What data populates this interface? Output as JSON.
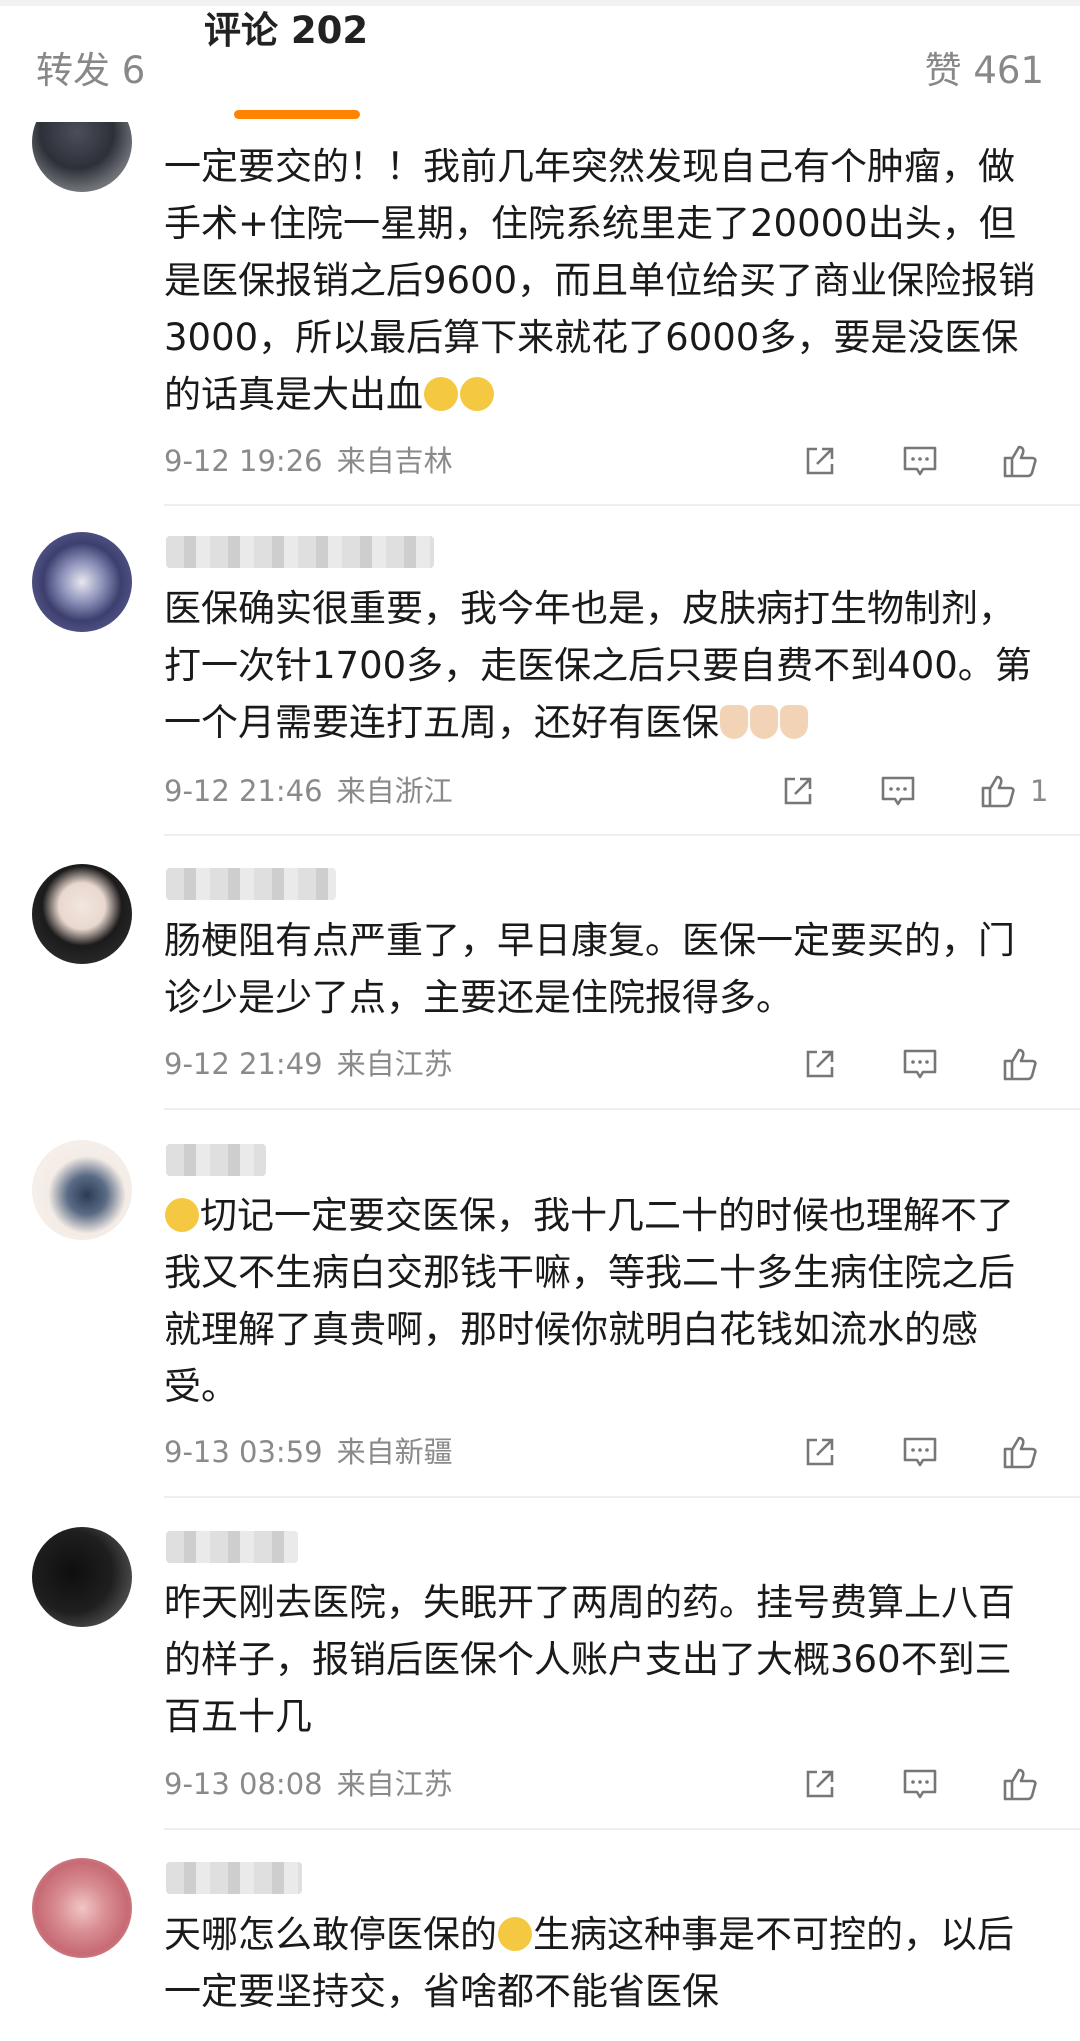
{
  "tabs": {
    "reposts": "转发 6",
    "comments": "评论 202",
    "likes": "赞 461"
  },
  "comments": [
    {
      "text_before": "一定要交的！！我前几年突然发现自己有个肿瘤，做手术+住院一星期，住院系统里走了20000出头，但是医保报销之后9600，而且单位给买了商业保险报销3000，所以最后算下来就花了6000多，要是没医保的话真是大出血",
      "emojis": [
        "cat-face-emoji",
        "cat-face-emoji"
      ],
      "date": "9-12 19:26",
      "location": "来自吉林",
      "likes": ""
    },
    {
      "text_before": "医保确实很重要，我今年也是，皮肤病打生物制剂，打一次针1700多，走医保之后只要自费不到400。第一个月需要连打五周，还好有医保",
      "emojis": [
        "praying-hands-emoji",
        "praying-hands-emoji",
        "praying-hands-emoji"
      ],
      "date": "9-12 21:46",
      "location": "来自浙江",
      "likes": "1"
    },
    {
      "text_before": "肠梗阻有点严重了，早日康复。医保一定要买的，门诊少是少了点，主要还是住院报得多。",
      "emojis": [],
      "date": "9-12 21:49",
      "location": "来自江苏",
      "likes": ""
    },
    {
      "text_before": "切记一定要交医保，我十几二十的时候也理解不了我又不生病白交那钱干嘛，等我二十多生病住院之后就理解了真贵啊，那时候你就明白花钱如流水的感受。",
      "lead_emoji": "cat-face-emoji",
      "emojis": [],
      "date": "9-13 03:59",
      "location": "来自新疆",
      "likes": ""
    },
    {
      "text_before": "昨天刚去医院，失眠开了两周的药。挂号费算上八百的样子，报销后医保个人账户支出了大概360不到三百五十几",
      "emojis": [],
      "date": "9-13 08:08",
      "location": "来自江苏",
      "likes": ""
    },
    {
      "text_before": "天哪怎么敢停医保的",
      "mid_emoji": "sweat-smile-emoji",
      "text_after": "生病这种事是不可控的，以后一定要坚持交，省啥都不能省医保",
      "emojis": [],
      "date": "",
      "location": "",
      "likes": ""
    }
  ],
  "colors": {
    "accent": "#ff8200",
    "meta_text": "#8a8a8a",
    "divider": "#eeeeee"
  },
  "icons": [
    "share-icon",
    "comment-icon",
    "like-icon"
  ]
}
